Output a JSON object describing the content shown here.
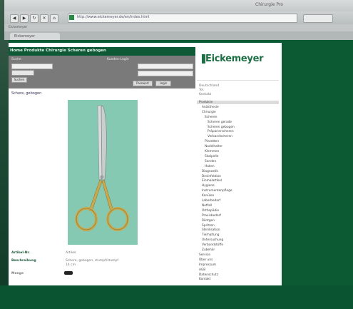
{
  "window": {
    "title": "Chirurgie Pro"
  },
  "browser": {
    "url": "http://www.eickemeyer.de/en/index.html",
    "bookmarks": "Eickemeyer",
    "tab": "Eickemeyer"
  },
  "breadcrumb": "Home  Produkte  Chirurgie  Scheren gebogen",
  "search": {
    "field1_label": "Suche",
    "field2_label": "Kunden-Login",
    "button1": "Suchen",
    "button2": "Passwort",
    "button3": "Login"
  },
  "product": {
    "heading": "Schere, gebogen",
    "image_alt": "Schere",
    "article_label": "Artikel-Nr.",
    "article_value": "Artikel",
    "desc_label": "Beschreibung",
    "desc_line1": "Schere, gebogen, stumpf/stumpf",
    "desc_line2": "14 cm",
    "order_label": "Menge"
  },
  "logo": {
    "text": "Eickemeyer"
  },
  "side": {
    "line1": "Deutschland",
    "line2": "Tel.",
    "line3": "Kontakt"
  },
  "nav": [
    "Produkte",
    "Anästhesie",
    "Chirurgie",
    "Scheren",
    "Scheren gerade",
    "Scheren gebogen",
    "Präparierscheren",
    "Verbandscheren",
    "Pinzetten",
    "Nadelhalter",
    "Klemmen",
    "Skalpelle",
    "Sonden",
    "Haken",
    "Diagnostik",
    "Desinfektion",
    "Einmalartikel",
    "Hygiene",
    "Instrumentenpflege",
    "Kanülen",
    "Laborbedarf",
    "Notfall",
    "Orthopädie",
    "Praxisbedarf",
    "Röntgen",
    "Spritzen",
    "Sterilisation",
    "Tierhaltung",
    "Untersuchung",
    "Verbandstoffe",
    "Zubehör",
    "Service",
    "Über uns",
    "Impressum",
    "AGB",
    "Datenschutz",
    "Kontakt"
  ]
}
